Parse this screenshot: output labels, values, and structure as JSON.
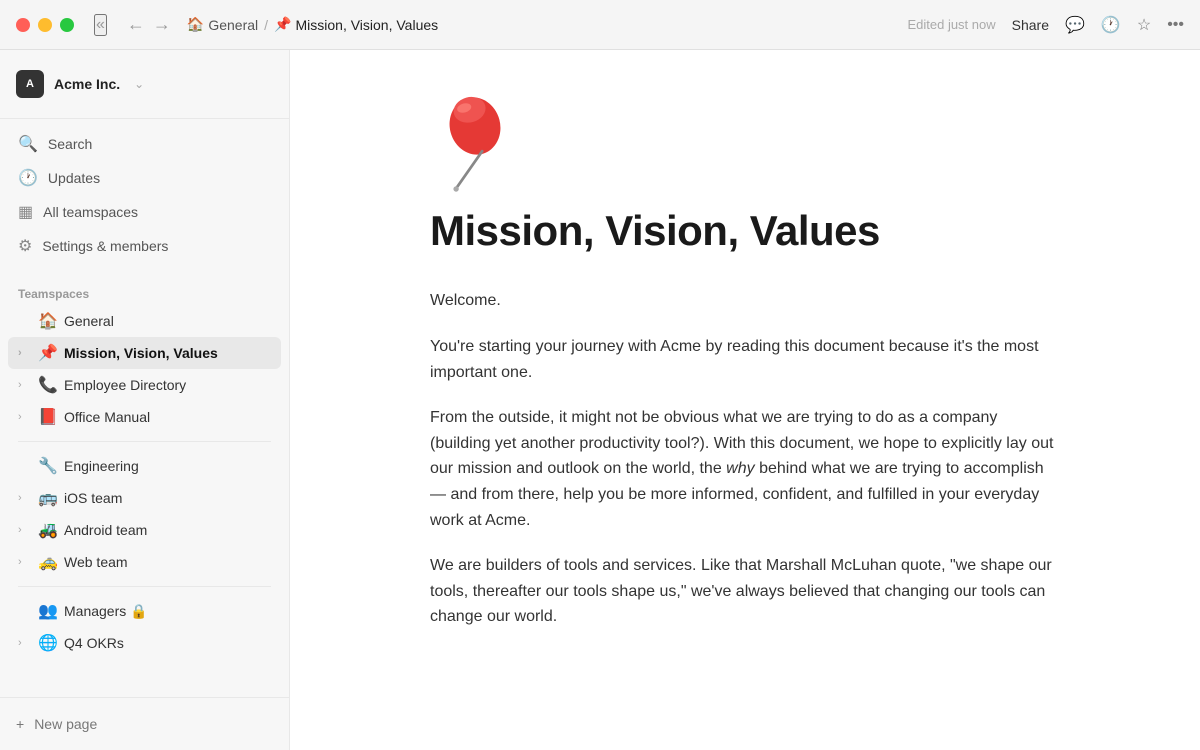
{
  "titlebar": {
    "breadcrumb": {
      "parent_icon": "🏠",
      "parent_label": "General",
      "separator": "/",
      "current_icon": "📌",
      "current_label": "Mission, Vision, Values"
    },
    "edited_text": "Edited just now",
    "share_label": "Share",
    "collapse_icon": "«"
  },
  "sidebar": {
    "workspace": {
      "logo_text": "A",
      "name": "Acme Inc.",
      "chevron": "⌄"
    },
    "nav_items": [
      {
        "icon": "🔍",
        "label": "Search"
      },
      {
        "icon": "🕐",
        "label": "Updates"
      },
      {
        "icon": "▦",
        "label": "All teamspaces"
      },
      {
        "icon": "⚙",
        "label": "Settings & members"
      }
    ],
    "teamspaces_label": "Teamspaces",
    "general_section": [
      {
        "icon": "🏠",
        "label": "General",
        "chevron": ""
      },
      {
        "icon": "📌",
        "label": "Mission, Vision, Values",
        "chevron": "›",
        "active": true
      },
      {
        "icon": "📞",
        "label": "Employee Directory",
        "chevron": "›"
      },
      {
        "icon": "📕",
        "label": "Office Manual",
        "chevron": "›"
      }
    ],
    "engineering_section": [
      {
        "icon": "🔧",
        "label": "Engineering",
        "chevron": ""
      },
      {
        "icon": "🚌",
        "label": "iOS team",
        "chevron": "›"
      },
      {
        "icon": "🚜",
        "label": "Android team",
        "chevron": "›"
      },
      {
        "icon": "🚕",
        "label": "Web team",
        "chevron": "›"
      }
    ],
    "managers_section": [
      {
        "icon": "👥",
        "label": "Managers 🔒",
        "chevron": ""
      },
      {
        "icon": "🌐",
        "label": "Q4 OKRs",
        "chevron": "›"
      }
    ],
    "new_page_label": "New page",
    "new_page_icon": "+"
  },
  "content": {
    "emoji": "📌",
    "title": "Mission, Vision, Values",
    "paragraphs": [
      {
        "id": "p1",
        "text": "Welcome.",
        "italic_parts": []
      },
      {
        "id": "p2",
        "text": "You're starting your journey with Acme by reading this document because it's the most important one.",
        "italic_parts": []
      },
      {
        "id": "p3",
        "text": "From the outside, it might not be obvious what we are trying to do as a company (building yet another productivity tool?). With this document, we hope to explicitly lay out our mission and outlook on the world, the why behind what we are trying to accomplish — and from there, help you be more informed, confident, and fulfilled in your everyday work at Acme.",
        "italic_word": "why"
      },
      {
        "id": "p4",
        "text": "We are builders of tools and services. Like that Marshall McLuhan quote, \"we shape our tools, thereafter our tools shape us,\" we've always believed that changing our tools can change our world.",
        "italic_parts": []
      }
    ]
  }
}
